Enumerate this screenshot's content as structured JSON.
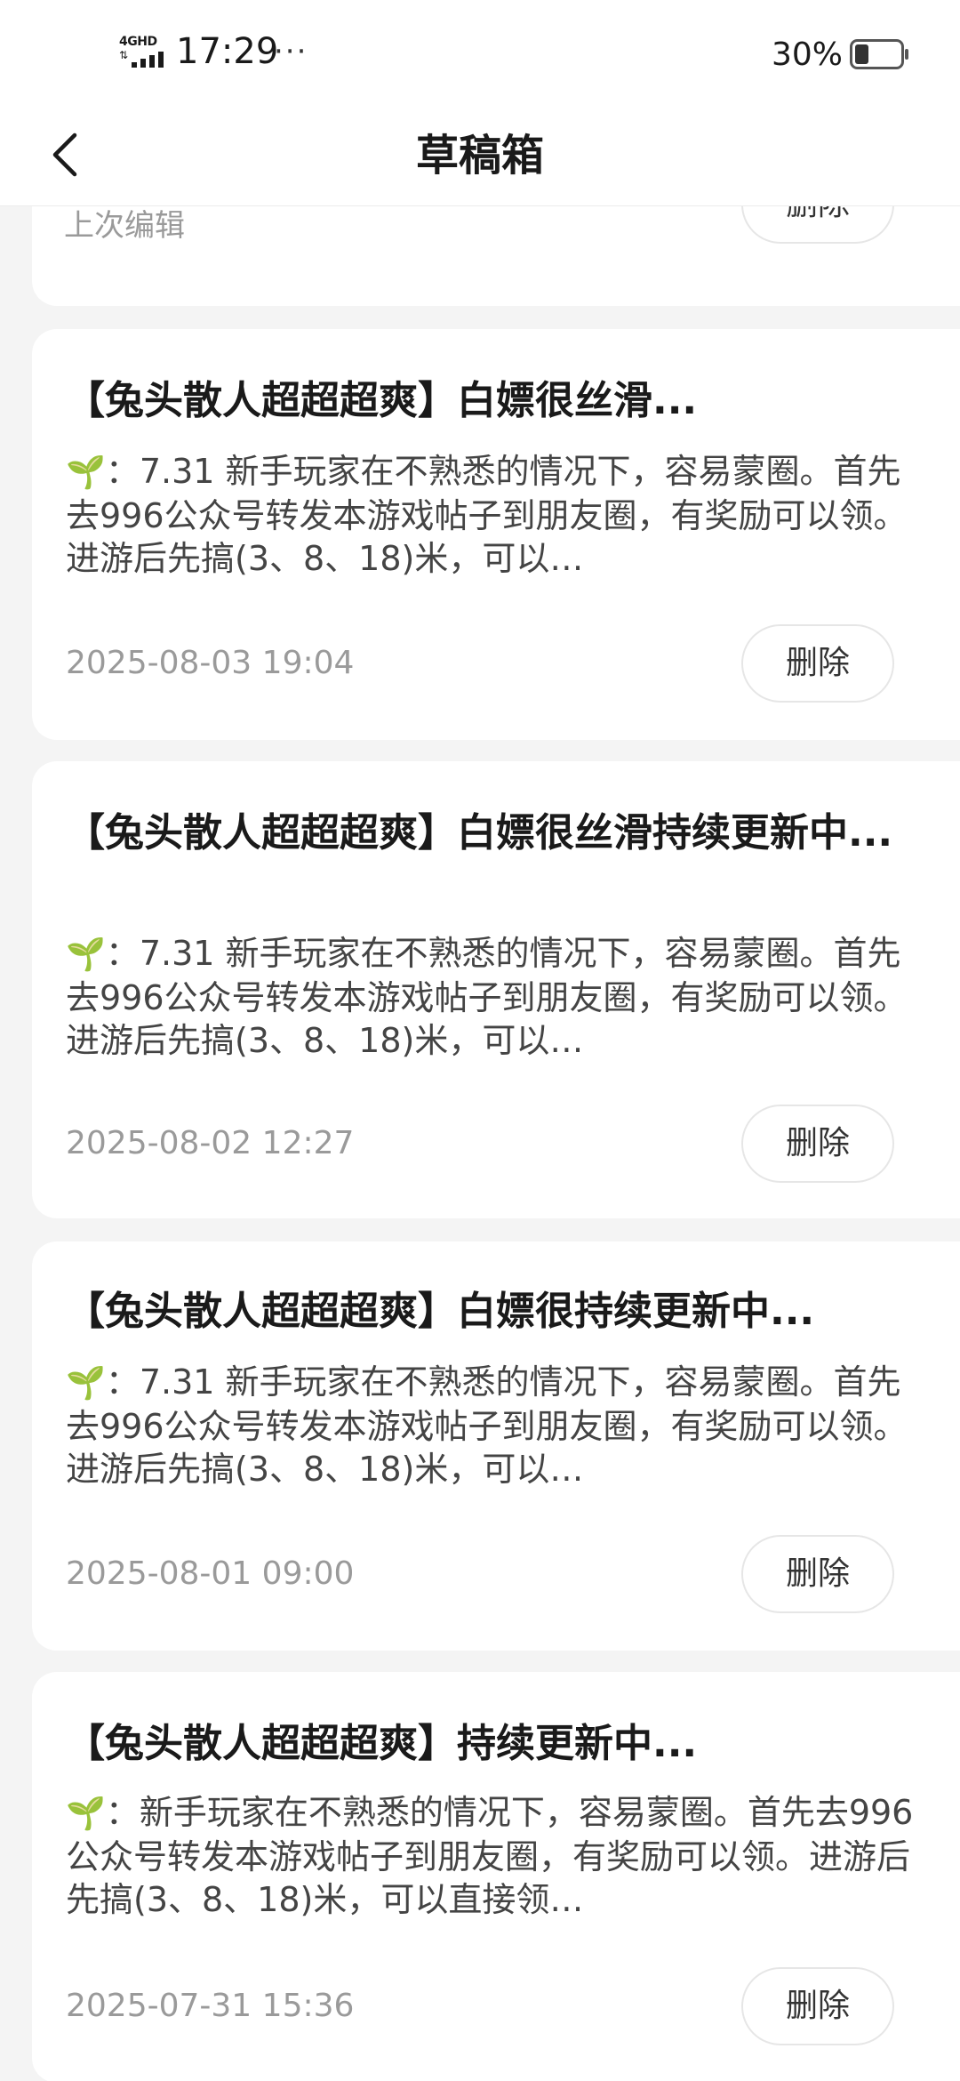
{
  "status_bar": {
    "network": "4GHD",
    "time": "17:29",
    "more": "···",
    "battery_percent": "30%",
    "battery_level": 0.3
  },
  "header": {
    "title": "草稿箱",
    "back_icon": "chevron-left-icon"
  },
  "partial_card": {
    "label": "上次编辑",
    "delete_label": "删除"
  },
  "drafts": [
    {
      "title": "【兔头散人超超超爽】白嫖很丝滑...",
      "sprout": "🌱",
      "body": "：7.31 新手玩家在不熟悉的情况下，容易蒙圈。首先去996公众号转发本游戏帖子到朋友圈，有奖励可以领。进游后先搞(3、8、18)米，可以…",
      "date": "2025-08-03 19:04",
      "delete_label": "删除"
    },
    {
      "title": "【兔头散人超超超爽】白嫖很丝滑持续更新中...",
      "sprout": "🌱",
      "body": "：7.31 新手玩家在不熟悉的情况下，容易蒙圈。首先去996公众号转发本游戏帖子到朋友圈，有奖励可以领。进游后先搞(3、8、18)米，可以…",
      "date": "2025-08-02 12:27",
      "delete_label": "删除"
    },
    {
      "title": "【兔头散人超超超爽】白嫖很持续更新中...",
      "sprout": "🌱",
      "body": "：7.31 新手玩家在不熟悉的情况下，容易蒙圈。首先去996公众号转发本游戏帖子到朋友圈，有奖励可以领。进游后先搞(3、8、18)米，可以…",
      "date": "2025-08-01 09:00",
      "delete_label": "删除"
    },
    {
      "title": "【兔头散人超超超爽】持续更新中...",
      "sprout": "🌱",
      "body": "：新手玩家在不熟悉的情况下，容易蒙圈。首先去996公众号转发本游戏帖子到朋友圈，有奖励可以领。进游后先搞(3、8、18)米，可以直接领…",
      "date": "2025-07-31 15:36",
      "delete_label": "删除"
    }
  ],
  "colors": {
    "page_background": "#f4f4f4",
    "card_background": "#ffffff",
    "title_text": "#1a1a1a",
    "body_text": "#444444",
    "date_text": "#9a9a9a",
    "button_border": "#e6e6e6"
  }
}
